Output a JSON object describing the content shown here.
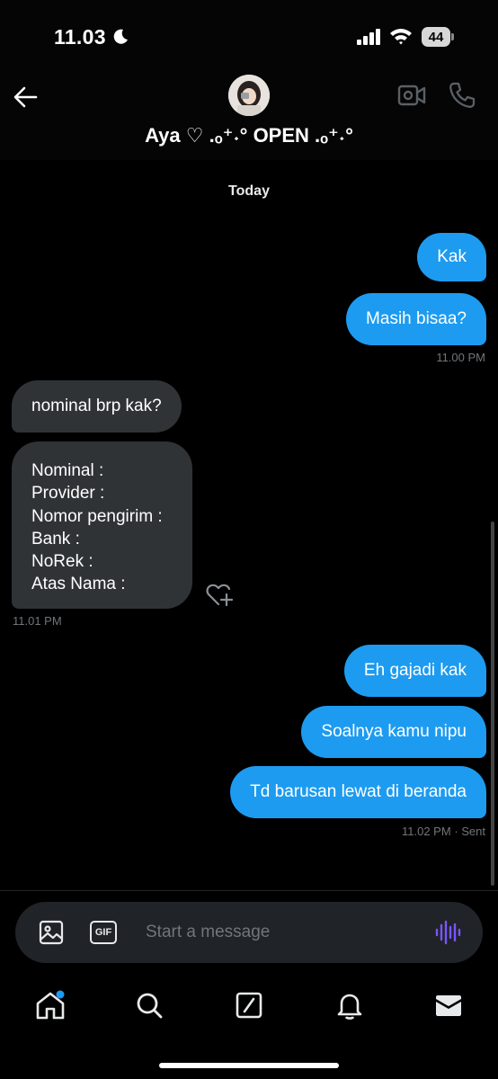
{
  "status_bar": {
    "time": "11.03",
    "battery": "44"
  },
  "header": {
    "contact_name": "Aya ♡ .ₒ⁺˖° OPEN .ₒ⁺˖°"
  },
  "date_separator": "Today",
  "messages": {
    "m1": "Kak",
    "m2": "Masih bisaa?",
    "t1": "11.00 PM",
    "m3": "nominal brp kak?",
    "details": [
      "Nominal :",
      "Provider :",
      "Nomor pengirim :",
      "Bank :",
      "NoRek :",
      "Atas Nama :"
    ],
    "t2": "11.01 PM",
    "m4": "Eh gajadi kak",
    "m5": "Soalnya kamu nipu",
    "m6": "Td barusan lewat di beranda",
    "t3_time": "11.02 PM",
    "t3_status": "· Sent"
  },
  "composer": {
    "placeholder": "Start a message",
    "gif_label": "GIF"
  },
  "colors": {
    "sent_bubble": "#1d9bf0",
    "received_bubble": "#2f3336",
    "voice_accent": "#7856ff"
  },
  "icons": {
    "back": "arrow-left-icon",
    "video": "video-camera-icon",
    "phone": "phone-icon",
    "media": "image-icon",
    "gif": "gif-icon",
    "voice": "waveform-icon",
    "nav": [
      "home-icon",
      "search-icon",
      "grok-icon",
      "bell-icon",
      "mail-icon"
    ]
  }
}
